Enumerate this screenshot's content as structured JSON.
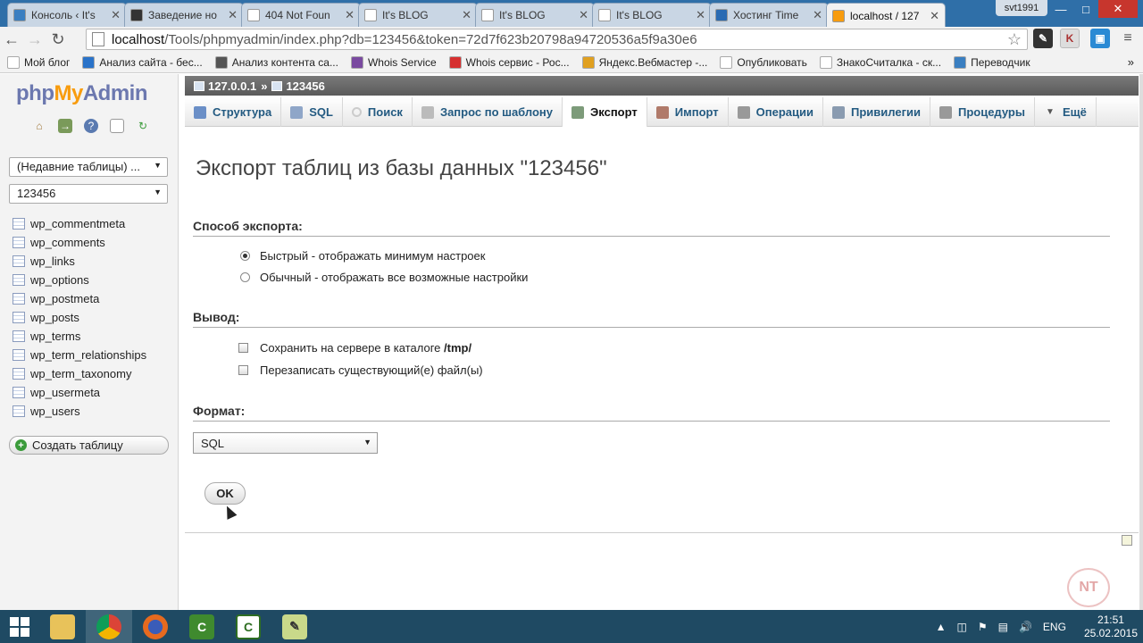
{
  "browser": {
    "tabs": [
      {
        "label": "Консоль ‹ It's",
        "icon_color": "#3a7fc1"
      },
      {
        "label": "Заведение но",
        "icon_color": "#333333"
      },
      {
        "label": "404 Not Foun",
        "icon_color": "#ffffff"
      },
      {
        "label": "It's BLOG",
        "icon_color": "#ffffff"
      },
      {
        "label": "It's BLOG",
        "icon_color": "#ffffff"
      },
      {
        "label": "It's BLOG",
        "icon_color": "#ffffff"
      },
      {
        "label": "Хостинг Time",
        "icon_color": "#2a6bb3"
      },
      {
        "label": "localhost / 127",
        "icon_color": "#f89c0e",
        "active": true
      }
    ],
    "user": "svt1991",
    "url_host": "localhost",
    "url_rest": "/Tools/phpmyadmin/index.php?db=123456&token=72d7f623b20798a94720536a5f9a30e6",
    "bookmarks": [
      {
        "label": "Мой блог",
        "color": "#ffffff"
      },
      {
        "label": "Анализ сайта - бес...",
        "color": "#2a73c9"
      },
      {
        "label": "Анализ контента са...",
        "color": "#555555"
      },
      {
        "label": "Whois Service",
        "color": "#7a4aa0"
      },
      {
        "label": "Whois сервис - Рос...",
        "color": "#d63030"
      },
      {
        "label": "Яндекс.Вебмастер -...",
        "color": "#e0a020"
      },
      {
        "label": "Опубликовать",
        "color": "#ffffff"
      },
      {
        "label": "ЗнакоСчиталка - ск...",
        "color": "#ffffff"
      },
      {
        "label": "Переводчик",
        "color": "#3a7fc1"
      }
    ]
  },
  "sidebar": {
    "logo_php": "php",
    "logo_my": "My",
    "logo_admin": "Admin",
    "recent_select": "(Недавние таблицы) ...",
    "db_select": "123456",
    "tables": [
      "wp_commentmeta",
      "wp_comments",
      "wp_links",
      "wp_options",
      "wp_postmeta",
      "wp_posts",
      "wp_terms",
      "wp_term_relationships",
      "wp_term_taxonomy",
      "wp_usermeta",
      "wp_users"
    ],
    "create_table": "Создать таблицу"
  },
  "main": {
    "crumb_server": "127.0.0.1",
    "crumb_sep": "»",
    "crumb_db": "123456",
    "tabs": [
      {
        "label": "Структура",
        "icon": "structure-icon",
        "color": "#6b8fc7"
      },
      {
        "label": "SQL",
        "icon": "sql-icon",
        "color": "#8fa6c8"
      },
      {
        "label": "Поиск",
        "icon": "search-icon",
        "color": "#cccccc"
      },
      {
        "label": "Запрос по шаблону",
        "icon": "query-icon",
        "color": "#bbbbbb"
      },
      {
        "label": "Экспорт",
        "icon": "export-icon",
        "color": "#7d9b7a",
        "active": true
      },
      {
        "label": "Импорт",
        "icon": "import-icon",
        "color": "#b07a6a"
      },
      {
        "label": "Операции",
        "icon": "wrench-icon",
        "color": "#999999"
      },
      {
        "label": "Привилегии",
        "icon": "privileges-icon",
        "color": "#8a9bb0"
      },
      {
        "label": "Процедуры",
        "icon": "procedures-icon",
        "color": "#999999"
      },
      {
        "label": "Ещё",
        "icon": "more-icon",
        "color": "#555555"
      }
    ],
    "title": "Экспорт таблиц из базы данных \"123456\"",
    "export_method_label": "Способ экспорта:",
    "quick_option": "Быстрый - отображать минимум настроек",
    "custom_option": "Обычный - отображать все возможные настройки",
    "output_label": "Вывод:",
    "save_on_server_prefix": "Сохранить на сервере в каталоге ",
    "save_on_server_dir": "/tmp/",
    "overwrite_label": "Перезаписать существующий(е) файл(ы)",
    "format_label": "Формат:",
    "format_value": "SQL",
    "ok_label": "OK"
  },
  "watermark": "NT",
  "taskbar": {
    "lang": "ENG",
    "time": "21:51",
    "date": "25.02.2015"
  }
}
